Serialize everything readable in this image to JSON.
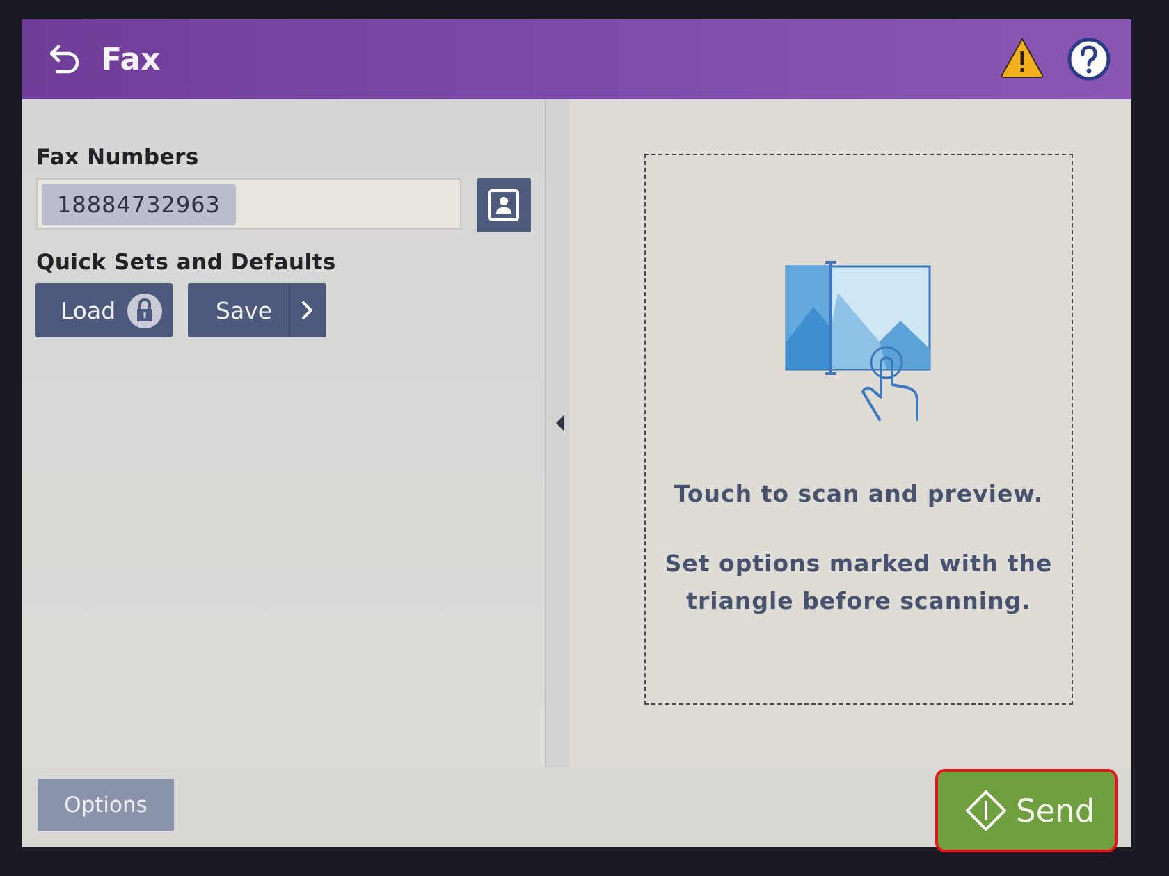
{
  "header": {
    "title": "Fax",
    "icons": {
      "back": "back-arrow-icon",
      "warning": "warning-triangle-icon",
      "help": "help-question-icon"
    }
  },
  "left": {
    "fax_numbers_label": "Fax Numbers",
    "fax_number_value": "18884732963",
    "quick_sets_label": "Quick Sets and Defaults",
    "load_label": "Load",
    "save_label": "Save"
  },
  "preview": {
    "line1": "Touch to scan and preview.",
    "line2a": "Set options marked with the",
    "line2b": "triangle before scanning."
  },
  "footer": {
    "options_label": "Options",
    "send_label": "Send"
  },
  "colors": {
    "header": "#7b4aa8",
    "button_dark": "#4d5a7d",
    "send_green": "#6f9f3e",
    "highlight_red": "#e0161a",
    "warning_yellow": "#f2b01e"
  }
}
